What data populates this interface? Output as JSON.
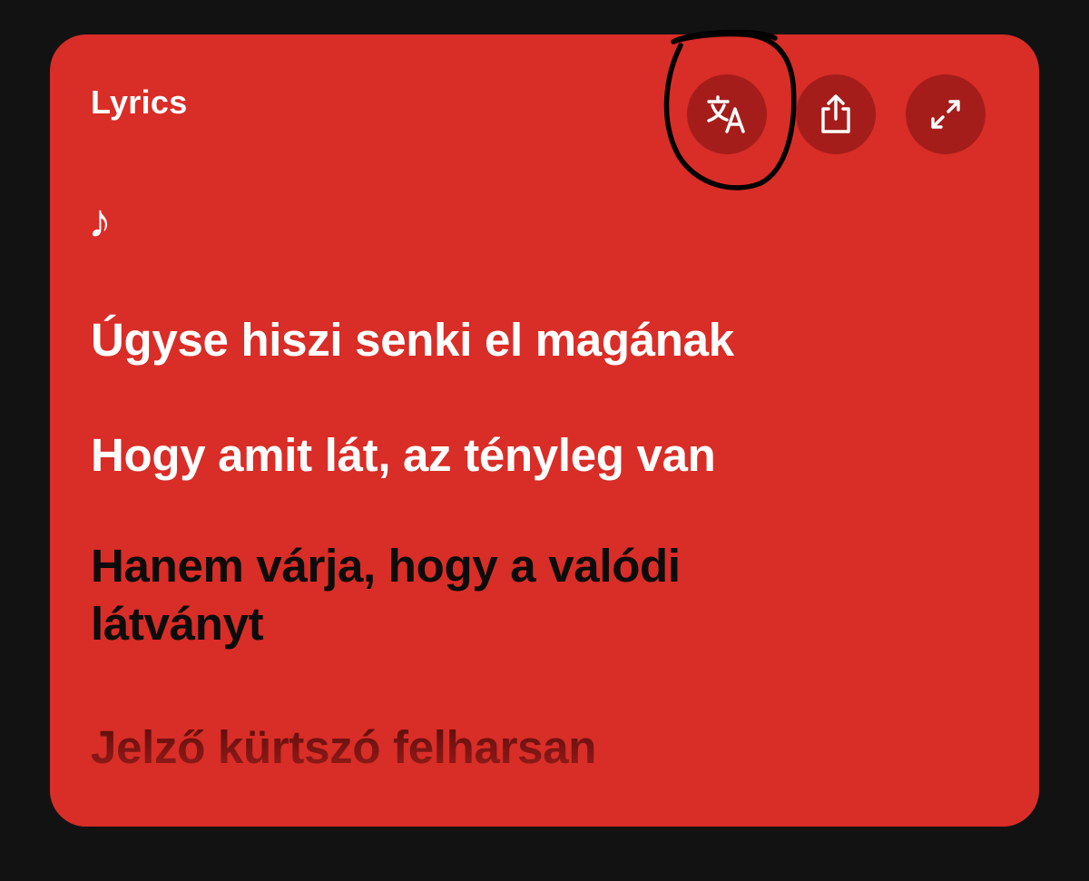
{
  "panel": {
    "title": "Lyrics"
  },
  "controls": [
    {
      "name": "translate",
      "icon": "translate-icon"
    },
    {
      "name": "share",
      "icon": "share-icon"
    },
    {
      "name": "expand",
      "icon": "expand-icon"
    }
  ],
  "lyrics": {
    "intro_symbol": "♪",
    "lines": [
      {
        "text": "Úgyse hiszi senki el magának",
        "state": "past"
      },
      {
        "text": "Hogy amit lát, az tényleg van",
        "state": "past"
      },
      {
        "text": "Hanem várja, hogy a valódi látványt",
        "state": "current"
      },
      {
        "text": "Jelző kürtszó felharsan",
        "state": "upcoming"
      }
    ]
  },
  "colors": {
    "page_background": "#121212",
    "card_background": "#d92d27",
    "button_background": "#a51d1b",
    "past_line": "#ffffff",
    "current_line": "#0c0c0c",
    "annotation_stroke": "#000000"
  }
}
